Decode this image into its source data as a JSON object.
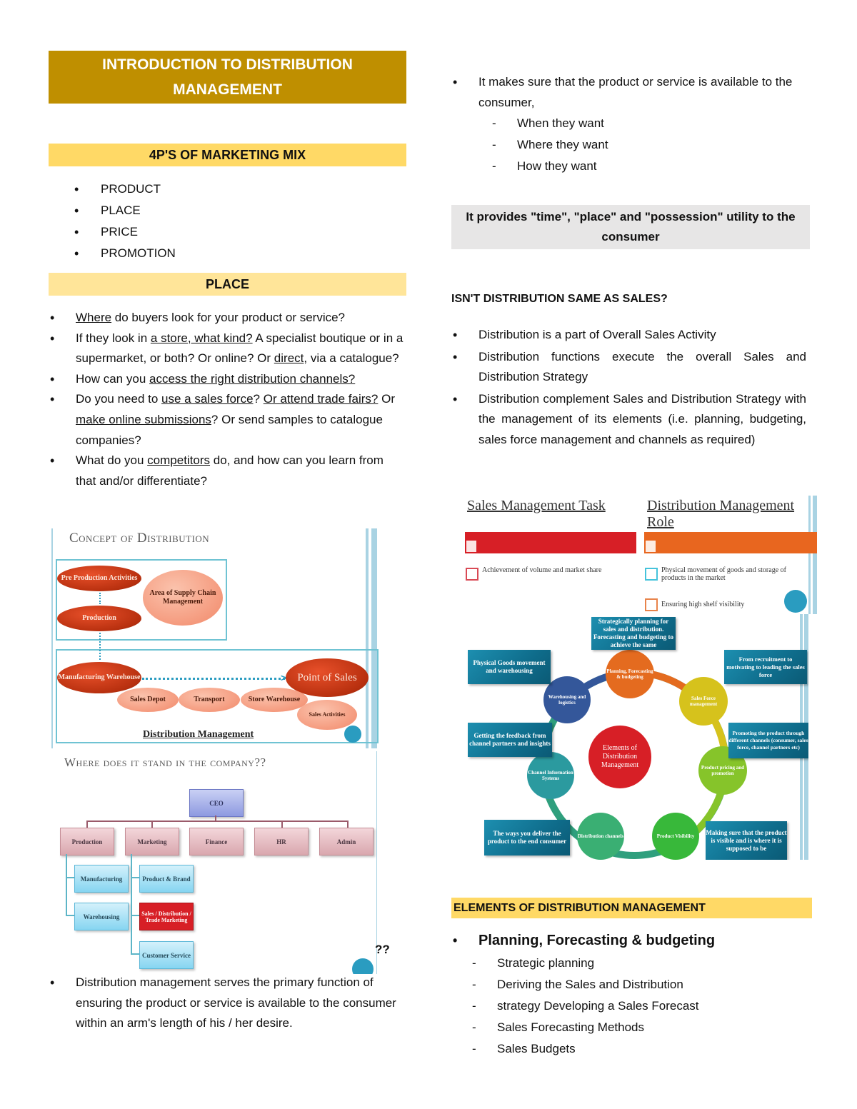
{
  "left": {
    "title": "INTRODUCTION TO DISTRIBUTION MANAGEMENT",
    "marketing_mix": {
      "heading": "4P'S OF MARKETING MIX",
      "items": [
        "PRODUCT",
        "PLACE",
        "PRICE",
        "PROMOTION"
      ]
    },
    "place": {
      "heading": "PLACE",
      "q1": {
        "u": "Where",
        "rest": " do buyers look for your product or service?"
      },
      "q2": {
        "a": "If they look in ",
        "u1": "a store, what kind?",
        "b": " A specialist boutique or in a supermarket, or both? Or online? Or ",
        "u2": "direct",
        "c": ", via a catalogue?"
      },
      "q3": {
        "a": "How can you ",
        "u": "access the right distribution channels?"
      },
      "q4": {
        "a": "Do you need to ",
        "u1": "use a sales force",
        "b": "? ",
        "u2": "Or attend trade fairs?",
        "c": " Or ",
        "u3": "make online submissions",
        "d": "? Or send samples to catalogue companies?"
      },
      "q5": {
        "a": "What do you ",
        "u": "competitors",
        "b": " do, and how can you learn from that and/or differentiate?"
      }
    },
    "concept_diagram": {
      "title": "Concept of Distribution",
      "nodes": {
        "pre_production": "Pre Production Activities",
        "production": "Production",
        "supply_chain": "Area of Supply Chain Management",
        "manufacturing_warehouse": "Manufacturing Warehouse",
        "sales_depot": "Sales Depot",
        "transport": "Transport",
        "store_warehouse": "Store Warehouse",
        "point_of_sales": "Point of Sales",
        "sales_activities": "Sales Activities"
      },
      "caption": "Distribution Management"
    },
    "org_chart": {
      "title": "Where does it stand in the company??",
      "ceo": "CEO",
      "departments": [
        "Production",
        "Marketing",
        "Finance",
        "HR",
        "Admin"
      ],
      "production_children": [
        "Manufacturing",
        "Warehousing"
      ],
      "marketing_children": [
        "Product & Brand",
        "Sales / Distribution / Trade Marketing",
        "Customer Service"
      ],
      "stray_text": "??"
    },
    "summary": "Distribution management serves the primary function of ensuring the product or service is available to the consumer within an arm's length of his / her desire."
  },
  "right": {
    "availability": {
      "text": "It makes sure that the product or service is available to the consumer,",
      "subitems": [
        "When they want",
        "Where they want",
        "How they want"
      ]
    },
    "utility_box": "It provides \"time\", \"place\" and \"possession\" utility to the consumer",
    "sales_question": {
      "heading": "ISN'T DISTRIBUTION SAME AS SALES?",
      "items": [
        "Distribution is a part of Overall Sales Activity",
        "Distribution functions execute the overall Sales and Distribution Strategy",
        "Distribution complement Sales and Distribution Strategy with the management of its elements (i.e. planning, budgeting, sales force management and channels as required)"
      ]
    },
    "roles_diagram": {
      "sales_title": "Sales Management Task",
      "dist_title": "Distribution Management Role",
      "sales_items": [
        "Achievement of volume and market share"
      ],
      "dist_items": [
        "Physical movement of goods and storage of products in the market",
        "Ensuring high shelf visibility"
      ],
      "colors": {
        "sales": "#d71f26",
        "distribution": "#e8661f"
      }
    },
    "elements_diagram": {
      "center": "Elements of Distribution Management",
      "circles": [
        "Planning, Forecasting & budgeting",
        "Sales Force management",
        "Product pricing and promotion",
        "Product Visibility",
        "Distribution channels",
        "Channel Information Systems",
        "Warehousing and logistics"
      ],
      "descriptions": [
        "Strategically planning for sales and distribution. Forecasting and budgeting to achieve the same",
        "From recruitment to motivating to leading the sales force",
        "Promoting the product through different channels (consumer, sales force, channel partners etc)",
        "Making sure that the product is visible and is where it is supposed to be",
        "The ways you deliver the product to the end consumer",
        "Getting the feedback from channel partners and insights",
        "Physical Goods movement and warehousing"
      ]
    },
    "elements_section": {
      "heading": "ELEMENTS OF DISTRIBUTION MANAGEMENT",
      "main_item": "Planning, Forecasting & budgeting",
      "subitems": [
        "Strategic planning",
        "Deriving the Sales and Distribution",
        "strategy Developing a Sales Forecast",
        "Sales Forecasting Methods",
        "Sales Budgets"
      ]
    }
  }
}
